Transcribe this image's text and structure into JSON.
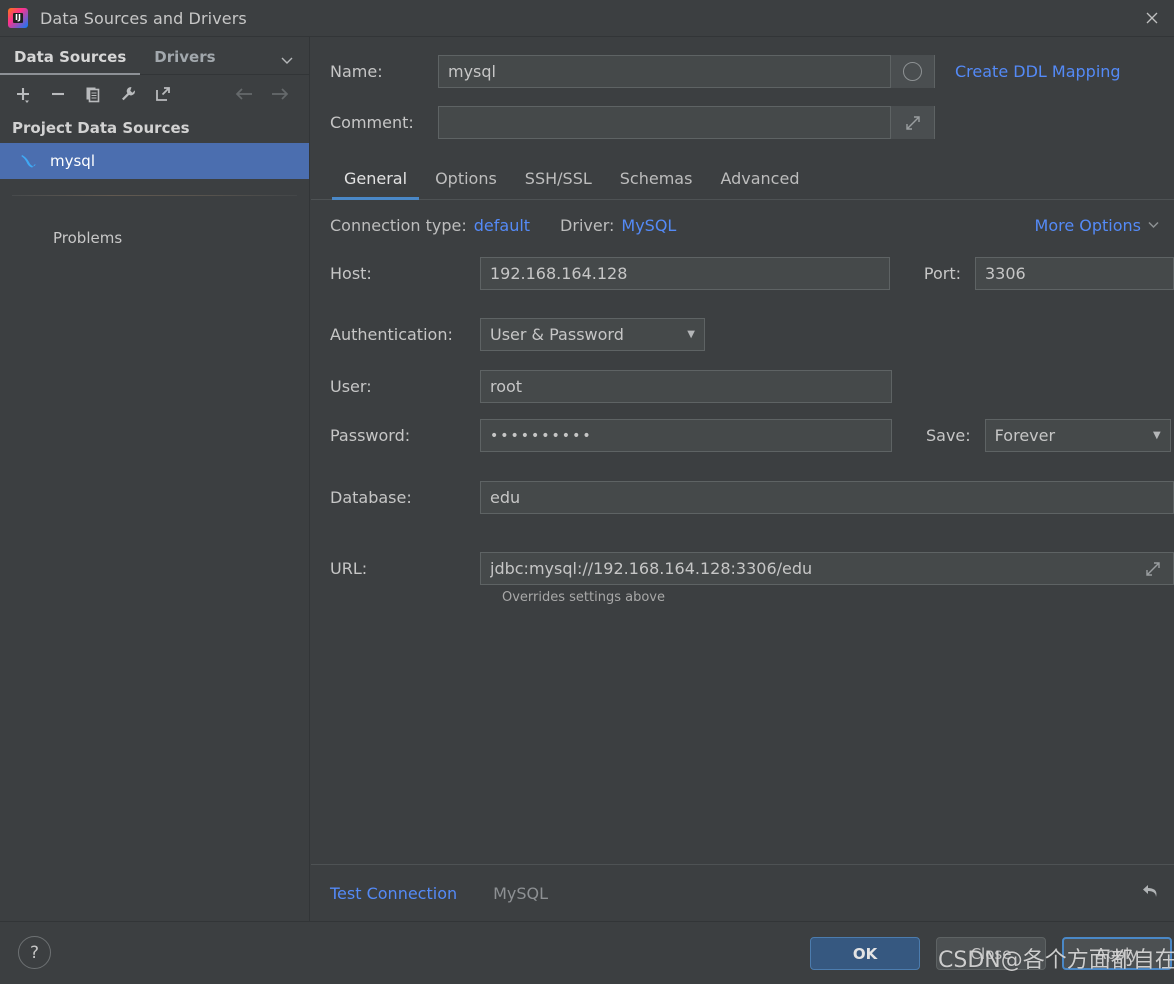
{
  "window": {
    "title": "Data Sources and Drivers",
    "logo_icon": "intellij-idea-logo-icon",
    "close_icon": "close-icon"
  },
  "left_panel": {
    "tabs": [
      {
        "label": "Data Sources",
        "selected": true
      },
      {
        "label": "Drivers",
        "selected": false
      }
    ],
    "tabs_chevron_icon": "chevron-down-icon",
    "toolbar": [
      {
        "name": "add-button",
        "icon": "plus-icon"
      },
      {
        "name": "remove-button",
        "icon": "minus-icon"
      },
      {
        "name": "duplicate-button",
        "icon": "copy-icon"
      },
      {
        "name": "properties-button",
        "icon": "wrench-icon"
      },
      {
        "name": "share-button",
        "icon": "external-link-icon"
      },
      {
        "name": "back-button",
        "icon": "arrow-left-icon"
      },
      {
        "name": "forward-button",
        "icon": "arrow-right-icon"
      }
    ],
    "section_title": "Project Data Sources",
    "data_sources": [
      {
        "label": "mysql",
        "icon": "mysql-dolphin-icon",
        "selected": true
      }
    ],
    "problems_label": "Problems"
  },
  "form": {
    "name_label": "Name:",
    "name_value": "mysql",
    "name_field_button_icon": "circle-icon",
    "comment_label": "Comment:",
    "comment_value": "",
    "comment_field_button_icon": "expand-icon",
    "create_ddl_mapping_link": "Create DDL Mapping"
  },
  "tabs": [
    {
      "label": "General",
      "selected": true
    },
    {
      "label": "Options",
      "selected": false
    },
    {
      "label": "SSH/SSL",
      "selected": false
    },
    {
      "label": "Schemas",
      "selected": false
    },
    {
      "label": "Advanced",
      "selected": false
    }
  ],
  "meta": {
    "connection_type_label": "Connection type:",
    "connection_type_value": "default",
    "driver_label": "Driver:",
    "driver_value": "MySQL",
    "more_options_label": "More Options",
    "more_options_icon": "chevron-down-icon"
  },
  "general": {
    "host_label": "Host:",
    "host_value": "192.168.164.128",
    "port_label": "Port:",
    "port_value": "3306",
    "authentication_label": "Authentication:",
    "authentication_value": "User & Password",
    "authentication_caret_icon": "caret-down-icon",
    "user_label": "User:",
    "user_value": "root",
    "password_label": "Password:",
    "password_value": "••••••••••",
    "save_label": "Save:",
    "save_value": "Forever",
    "save_caret_icon": "caret-down-icon",
    "database_label": "Database:",
    "database_value": "edu",
    "url_label": "URL:",
    "url_value": "jdbc:mysql://192.168.164.128:3306/edu",
    "url_field_button_icon": "expand-icon",
    "url_hint": "Overrides settings above"
  },
  "bottom_strip": {
    "test_connection_label": "Test Connection",
    "driver_status_label": "MySQL",
    "revert_icon": "revert-arrow-icon"
  },
  "footer": {
    "help_label": "?",
    "ok_label": "OK",
    "close_label": "Close",
    "apply_label": "Apply"
  },
  "watermark": "CSDN@各个方面都自在",
  "colors": {
    "background": "#3c3f41",
    "field_background": "#45494a",
    "field_border": "#5e6364",
    "accent_blue": "#548af7",
    "selection_blue": "#4b6eaf",
    "tab_underline": "#4a88c7",
    "ok_button": "#365880",
    "text": "#c6c6c6"
  }
}
